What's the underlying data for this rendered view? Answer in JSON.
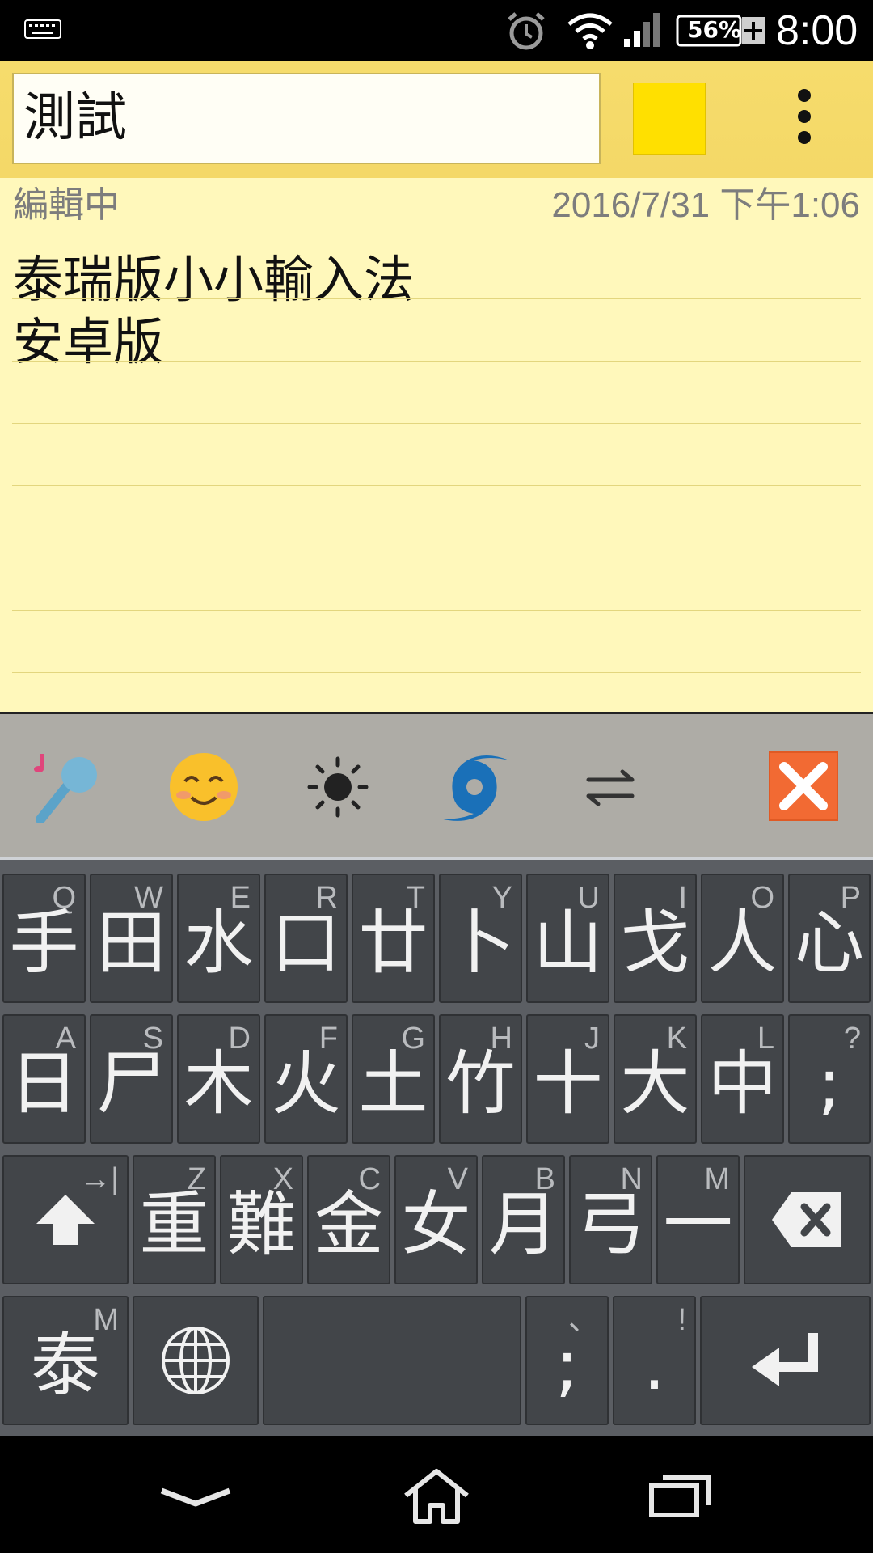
{
  "status_bar": {
    "battery_percent": "56%",
    "time": "8:00",
    "icons": [
      "keyboard-icon",
      "alarm-icon",
      "wifi-icon",
      "signal-icon",
      "battery-icon"
    ]
  },
  "toolbar": {
    "title": "測試",
    "note_color": "#ffe000",
    "menu_icon": "overflow-menu-icon"
  },
  "note": {
    "status": "編輯中",
    "timestamp": "2016/7/31 下午1:06",
    "lines": [
      "泰瑞版小小輸入法",
      "安卓版"
    ]
  },
  "ime_toolbar": {
    "icons": [
      "microphone-icon",
      "emoji-icon",
      "brightness-icon",
      "hurricane-icon",
      "swap-arrows-icon",
      "close-icon"
    ],
    "close_color": "#f26a33"
  },
  "keyboard": {
    "row1": [
      {
        "char": "手",
        "hint": "Q"
      },
      {
        "char": "田",
        "hint": "W"
      },
      {
        "char": "水",
        "hint": "E"
      },
      {
        "char": "口",
        "hint": "R"
      },
      {
        "char": "廿",
        "hint": "T"
      },
      {
        "char": "卜",
        "hint": "Y"
      },
      {
        "char": "山",
        "hint": "U"
      },
      {
        "char": "戈",
        "hint": "I"
      },
      {
        "char": "人",
        "hint": "O"
      },
      {
        "char": "心",
        "hint": "P"
      }
    ],
    "row2": [
      {
        "char": "日",
        "hint": "A"
      },
      {
        "char": "尸",
        "hint": "S"
      },
      {
        "char": "木",
        "hint": "D"
      },
      {
        "char": "火",
        "hint": "F"
      },
      {
        "char": "土",
        "hint": "G"
      },
      {
        "char": "竹",
        "hint": "H"
      },
      {
        "char": "十",
        "hint": "J"
      },
      {
        "char": "大",
        "hint": "K"
      },
      {
        "char": "中",
        "hint": "L"
      },
      {
        "char": ";",
        "hint": "?"
      }
    ],
    "row3": [
      {
        "char": "重",
        "hint": "Z"
      },
      {
        "char": "難",
        "hint": "X"
      },
      {
        "char": "金",
        "hint": "C"
      },
      {
        "char": "女",
        "hint": "V"
      },
      {
        "char": "月",
        "hint": "B"
      },
      {
        "char": "弓",
        "hint": "N"
      },
      {
        "char": "一",
        "hint": "M"
      }
    ],
    "shift_hint": "→|",
    "mode_key": {
      "char": "泰",
      "hint": "M"
    },
    "comma_key": {
      "char": ";",
      "hint": "、"
    },
    "period_key": {
      "char": ".",
      "hint": "!"
    },
    "special_icons": [
      "shift-icon",
      "backspace-icon",
      "globe-icon",
      "enter-icon"
    ]
  },
  "nav_bar": {
    "icons": [
      "back-chevron-icon",
      "home-icon",
      "recents-icon"
    ]
  }
}
